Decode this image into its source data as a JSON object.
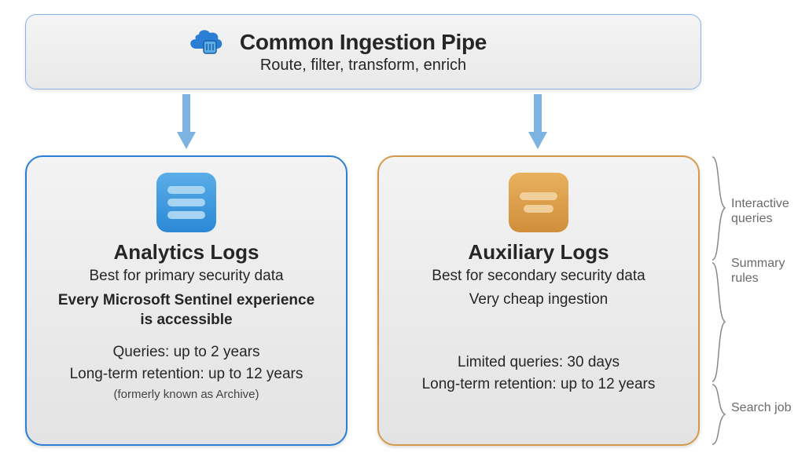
{
  "top": {
    "title": "Common Ingestion Pipe",
    "subtitle": "Route, filter, transform, enrich"
  },
  "analytics": {
    "title": "Analytics Logs",
    "subtitle": "Best for primary security data",
    "emphasis": "Every Microsoft Sentinel experience is accessible",
    "queries": "Queries: up to 2 years",
    "retention": "Long-term retention: up to 12 years",
    "retention_note": "(formerly known as Archive)"
  },
  "auxiliary": {
    "title": "Auxiliary Logs",
    "subtitle": "Best for secondary security data",
    "cheap": "Very cheap ingestion",
    "queries": "Limited queries: 30 days",
    "retention": "Long-term retention: up to 12 years"
  },
  "side": {
    "interactive": "Interactive queries",
    "summary": "Summary rules",
    "search": "Search job"
  }
}
